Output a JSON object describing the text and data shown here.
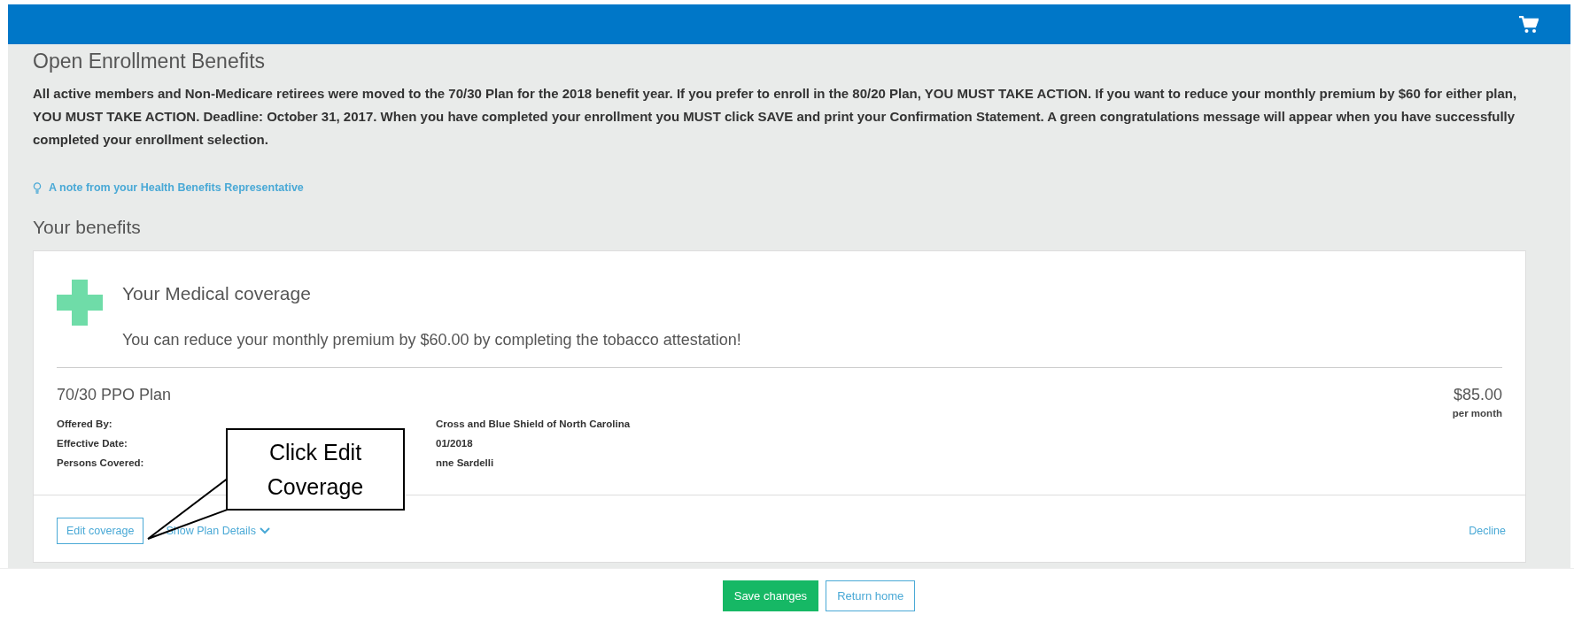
{
  "title": "Open Enrollment Benefits",
  "notice": "All active members and Non-Medicare retirees were moved to the 70/30 Plan for the 2018 benefit year. If you prefer to enroll in the 80/20 Plan, YOU MUST TAKE ACTION. If you want to reduce your monthly premium by $60 for either plan, YOU MUST TAKE ACTION. Deadline: October 31, 2017. When you have completed your enrollment you MUST click SAVE and print your Confirmation Statement. A green congratulations message will appear when you have successfully completed your enrollment selection.",
  "note_link": "A note from your Health Benefits Representative",
  "section_title": "Your benefits",
  "coverage": {
    "title": "Your Medical coverage",
    "message": "You can reduce your monthly premium by $60.00 by completing the tobacco attestation!",
    "plan": "70/30 PPO Plan",
    "price": "$85.00",
    "price_unit": "per month",
    "details": [
      {
        "label": "Offered By:",
        "value": "Cross and Blue Shield of North Carolina"
      },
      {
        "label": "Effective Date:",
        "value": "01/2018"
      },
      {
        "label": "Persons Covered:",
        "value": "nne Sardelli"
      }
    ],
    "actions": {
      "edit": "Edit coverage",
      "details": "Show Plan Details",
      "decline": "Decline"
    }
  },
  "callout": "Click Edit Coverage",
  "footer": {
    "save": "Save changes",
    "home": "Return home"
  }
}
